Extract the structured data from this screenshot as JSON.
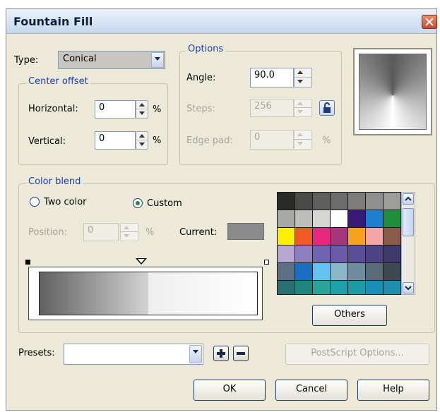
{
  "dialog": {
    "title": "Fountain Fill"
  },
  "type": {
    "label": "Type:",
    "value": "Conical"
  },
  "center_offset": {
    "legend": "Center offset",
    "horizontal": {
      "label": "Horizontal:",
      "value": "0",
      "unit": "%"
    },
    "vertical": {
      "label": "Vertical:",
      "value": "0",
      "unit": "%"
    }
  },
  "options": {
    "legend": "Options",
    "angle": {
      "label": "Angle:",
      "value": "90.0"
    },
    "steps": {
      "label": "Steps:",
      "value": "256"
    },
    "edge_pad": {
      "label": "Edge pad:",
      "value": "0",
      "unit": "%"
    }
  },
  "color_blend": {
    "legend": "Color blend",
    "two_color": {
      "label": "Two color",
      "selected": false
    },
    "custom": {
      "label": "Custom",
      "selected": true
    },
    "position": {
      "label": "Position:",
      "value": "0",
      "unit": "%"
    },
    "current": {
      "label": "Current:",
      "color": "#8a8a8a"
    },
    "others_label": "Others",
    "palette_colors": [
      "#2b2b28",
      "#4a4a48",
      "#5e5e5c",
      "#6c6c6b",
      "#7d7d7c",
      "#8f8f8e",
      "#9d9d9c",
      "#a9a9a8",
      "#bdbdbc",
      "#d5d5d4",
      "#ffffff",
      "#3b197b",
      "#1e7fcf",
      "#1f8f3e",
      "#ffef00",
      "#f15a24",
      "#e8287e",
      "#a6367a",
      "#f7a21b",
      "#f6a6a6",
      "#8a5a4a",
      "#b8a6d3",
      "#8e7ec2",
      "#6f63b3",
      "#6a5aa8",
      "#5b4e98",
      "#4d4486",
      "#3e3a6e",
      "#5c6f85",
      "#1a6fc2",
      "#63c2f0",
      "#8ab6c9",
      "#6e8da0",
      "#5a6c78",
      "#3e4a52",
      "#2a6f74",
      "#20867b",
      "#2aa39b",
      "#1f9fa9",
      "#1e9aa6",
      "#1a8fb9",
      "#1f8fb0"
    ]
  },
  "presets": {
    "label": "Presets:",
    "value": "",
    "postscript_label": "PostScript Options..."
  },
  "buttons": {
    "ok": "OK",
    "cancel": "Cancel",
    "help": "Help"
  }
}
